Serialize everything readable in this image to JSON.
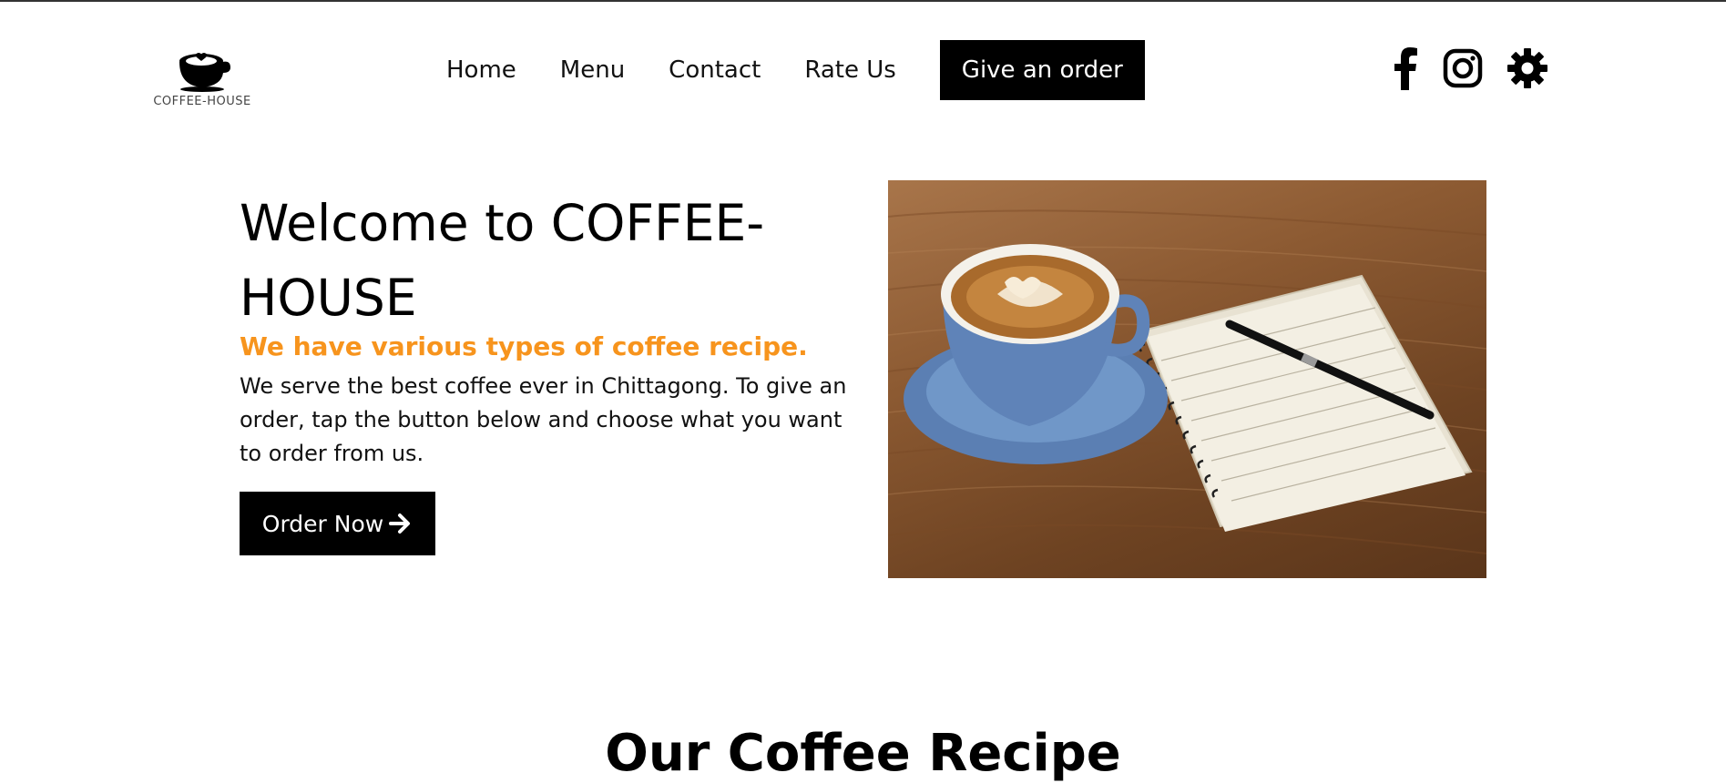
{
  "header": {
    "logo_text": "COFFEE-HOUSE",
    "nav": [
      {
        "label": "Home"
      },
      {
        "label": "Menu"
      },
      {
        "label": "Contact"
      },
      {
        "label": "Rate Us"
      }
    ],
    "order_button": "Give an order",
    "social_icons": [
      "facebook-icon",
      "instagram-icon",
      "gear-icon"
    ]
  },
  "hero": {
    "title": "Welcome to COFFEE-HOUSE",
    "subtitle": "We have various types of coffee recipe.",
    "text": "We serve the best coffee ever in Chittagong. To give an order, tap the button below and choose what you want to order from us.",
    "cta_label": "Order Now",
    "cta_icon": "arrow-right-icon"
  },
  "section": {
    "title": "Our Coffee Recipe"
  },
  "colors": {
    "accent": "#f7941d",
    "button_bg": "#000000",
    "button_text": "#ffffff"
  }
}
